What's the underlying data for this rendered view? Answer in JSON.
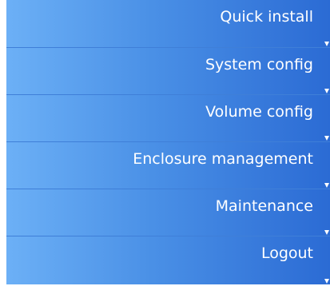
{
  "menu": {
    "items": [
      {
        "label": "Quick install"
      },
      {
        "label": "System config"
      },
      {
        "label": "Volume config"
      },
      {
        "label": "Enclosure management"
      },
      {
        "label": "Maintenance"
      },
      {
        "label": "Logout"
      }
    ]
  },
  "colors": {
    "gradient_left": "#6cb0f6",
    "gradient_mid": "#4a90e6",
    "gradient_right": "#2b6bd4",
    "divider": "#3f7fd8",
    "text": "#ffffff"
  }
}
